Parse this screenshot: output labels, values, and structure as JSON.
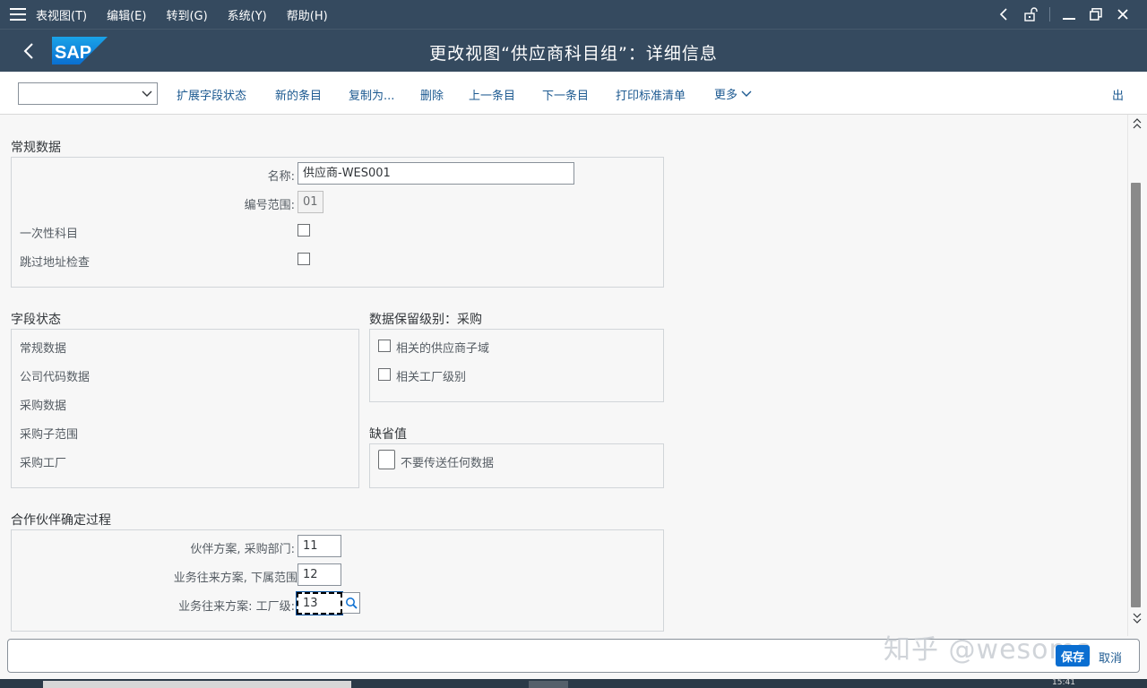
{
  "menubar": {
    "items": [
      "表视图(T)",
      "编辑(E)",
      "转到(G)",
      "系统(Y)",
      "帮助(H)"
    ]
  },
  "header": {
    "title": "更改视图“供应商科目组”：详细信息",
    "logo_text": "SAP"
  },
  "toolbar": {
    "combo_value": "",
    "buttons": [
      "扩展字段状态",
      "新的条目",
      "复制为...",
      "删除",
      "上一条目",
      "下一条目",
      "打印标准清单"
    ],
    "more_label": "更多",
    "exit_label": "出"
  },
  "general": {
    "title": "常规数据",
    "name_label": "名称:",
    "name_value": "供应商-WES001",
    "numrange_label": "编号范围:",
    "numrange_value": "01",
    "onetime_label": "一次性科目",
    "onetime_checked": false,
    "skipaddr_label": "跳过地址检查",
    "skipaddr_checked": false
  },
  "field_status": {
    "title": "字段状态",
    "items": [
      "常规数据",
      "公司代码数据",
      "采购数据",
      "采购子范围",
      "采购工厂"
    ]
  },
  "retention": {
    "title": "数据保留级别：采购",
    "items": [
      "相关的供应商子域",
      "相关工厂级别"
    ]
  },
  "defaults": {
    "title": "缺省值",
    "nosend_label": "不要传送任何数据"
  },
  "partner": {
    "title": "合作伙伴确定过程",
    "scheme_label": "伙伴方案, 采购部门:",
    "scheme_value": "11",
    "sub_label": "业务往来方案, 下属范围",
    "sub_value": "12",
    "plant_label": "业务往来方案: 工厂级:",
    "plant_value": "13"
  },
  "footer": {
    "save_label": "保存",
    "cancel_label": "取消",
    "watermark": "知乎 @wesoma",
    "clock": "15:41"
  },
  "colors": {
    "shell": "#354a5f",
    "accent": "#0a6ed1",
    "link": "#1d5a91"
  }
}
